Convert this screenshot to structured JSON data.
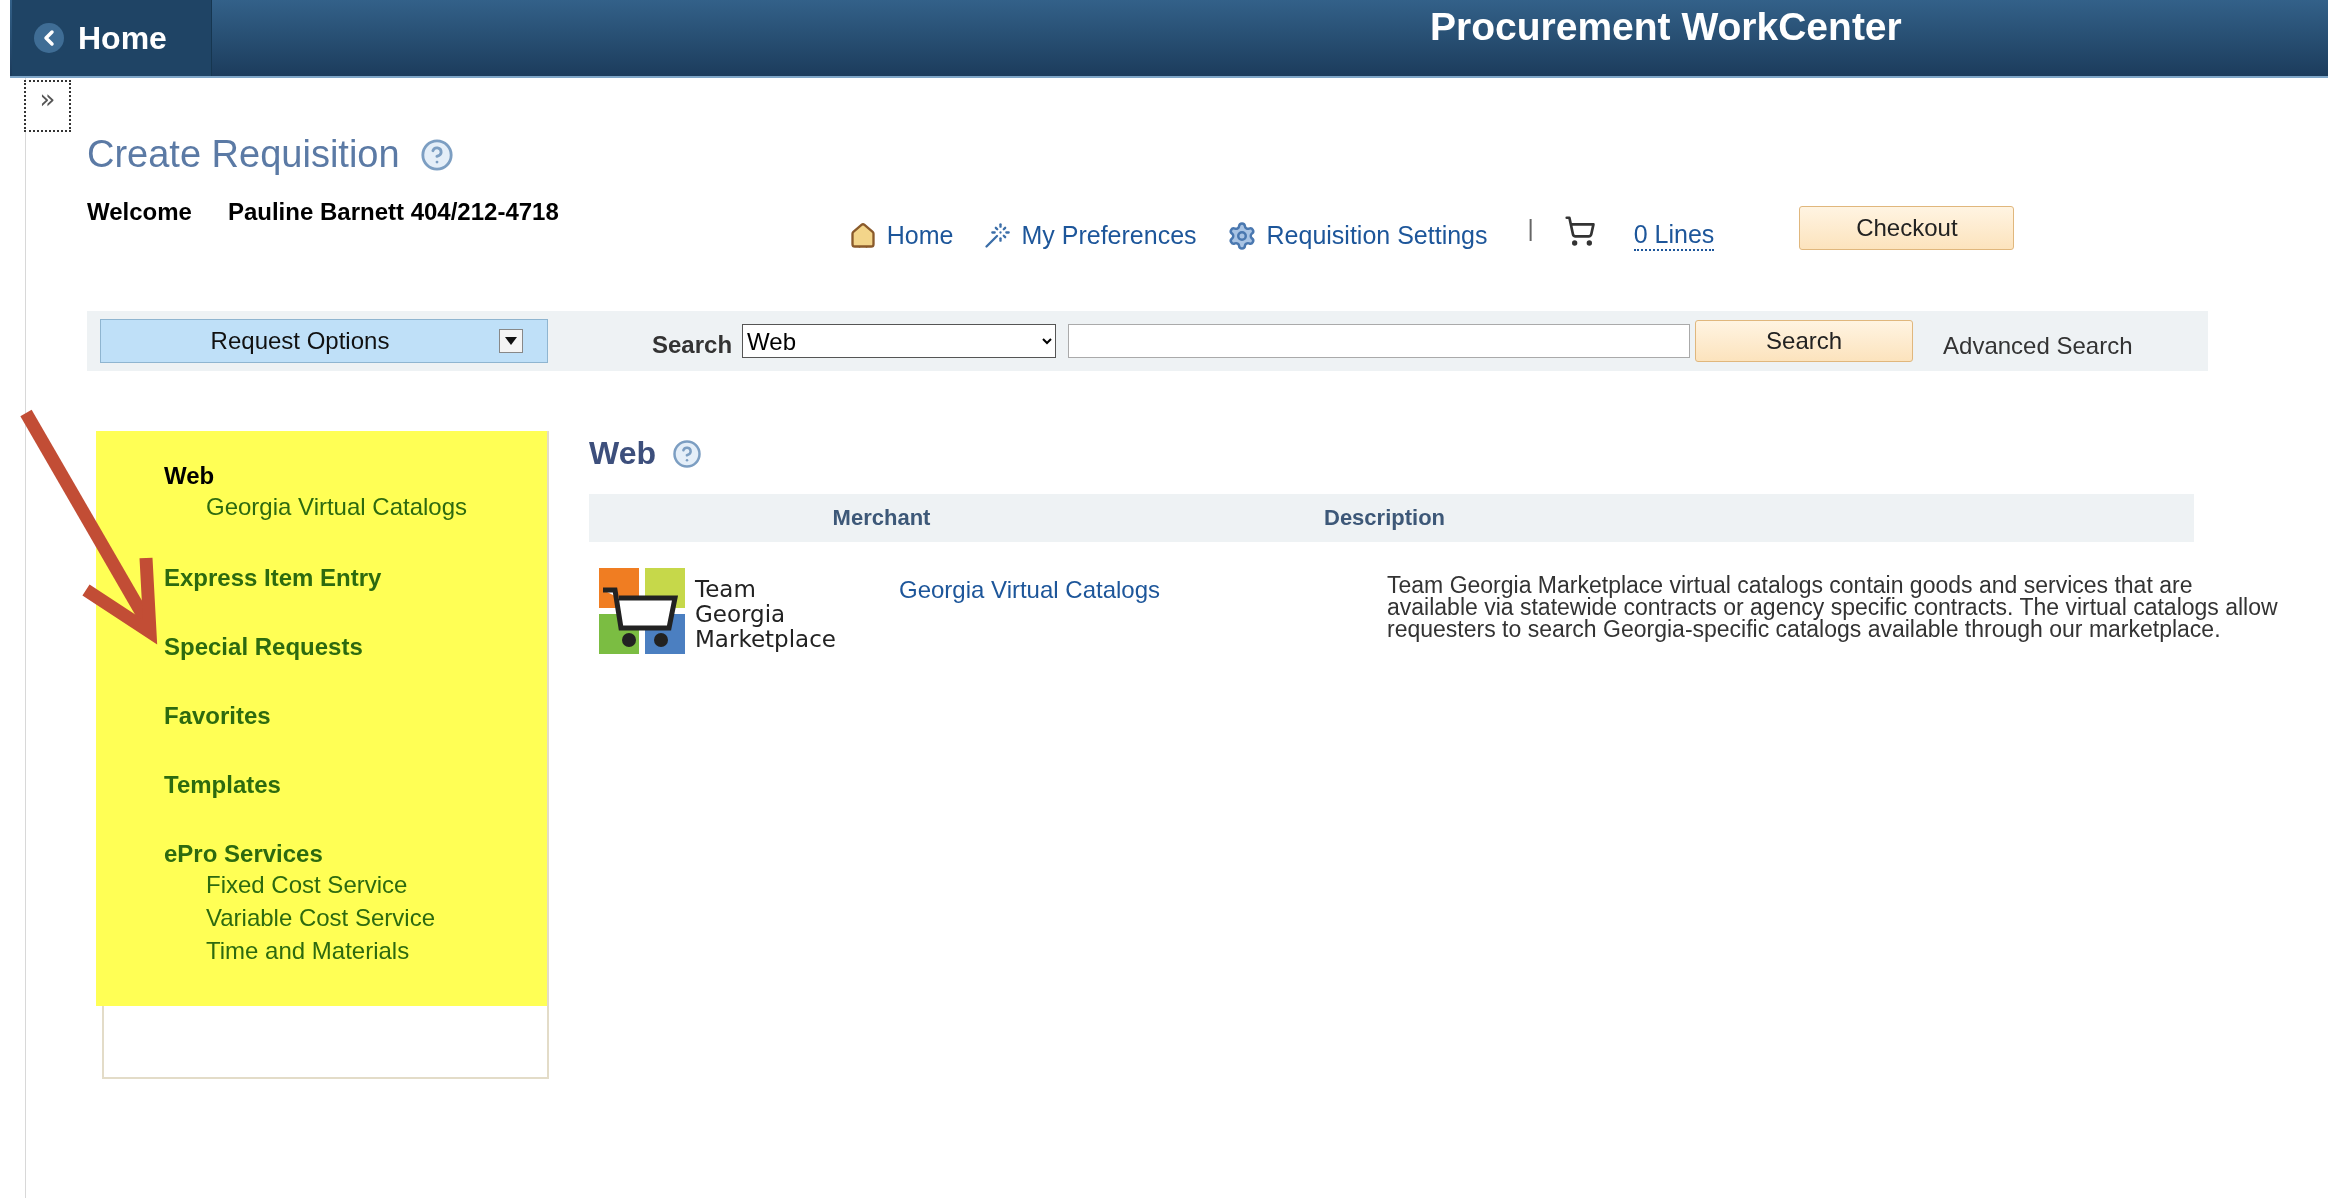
{
  "header": {
    "home_button": "Home",
    "title": "Procurement WorkCenter"
  },
  "collapse_toggle": "»",
  "page_title": "Create Requisition",
  "welcome": {
    "label": "Welcome",
    "user": "Pauline Barnett 404/212-4718"
  },
  "toolbar_links": [
    {
      "kind": "home",
      "label": "Home"
    },
    {
      "kind": "preferences",
      "label": "My Preferences"
    },
    {
      "kind": "settings",
      "label": "Requisition Settings"
    }
  ],
  "separator": "|",
  "cart": {
    "label": "0 Lines"
  },
  "checkout_button": "Checkout",
  "request_options": "Request Options",
  "search": {
    "label": "Search",
    "scope": "Web",
    "button": "Search",
    "advanced": "Advanced Search"
  },
  "sidebar": {
    "sections": [
      {
        "label": "Web",
        "selected": true,
        "children": [
          {
            "label": "Georgia Virtual Catalogs"
          }
        ]
      },
      {
        "label": "Express Item Entry",
        "selected": false
      },
      {
        "label": "Special Requests",
        "selected": false
      },
      {
        "label": "Favorites",
        "selected": false
      },
      {
        "label": "Templates",
        "selected": false
      },
      {
        "label": "ePro Services",
        "selected": false,
        "children": [
          {
            "label": "Fixed Cost Service"
          },
          {
            "label": "Variable Cost Service"
          },
          {
            "label": "Time and Materials"
          }
        ]
      }
    ]
  },
  "section_title": "Web",
  "table": {
    "columns": [
      "Merchant",
      "Description"
    ],
    "rows": [
      {
        "logo_lines": [
          "Team",
          "Georgia",
          "Marketplace"
        ],
        "merchant": "Georgia Virtual Catalogs",
        "description": "Team Georgia Marketplace virtual catalogs contain goods and services that are available via statewide contracts or agency specific contracts.  The virtual catalogs allow requesters to search Georgia-specific catalogs available through our marketplace."
      }
    ]
  }
}
